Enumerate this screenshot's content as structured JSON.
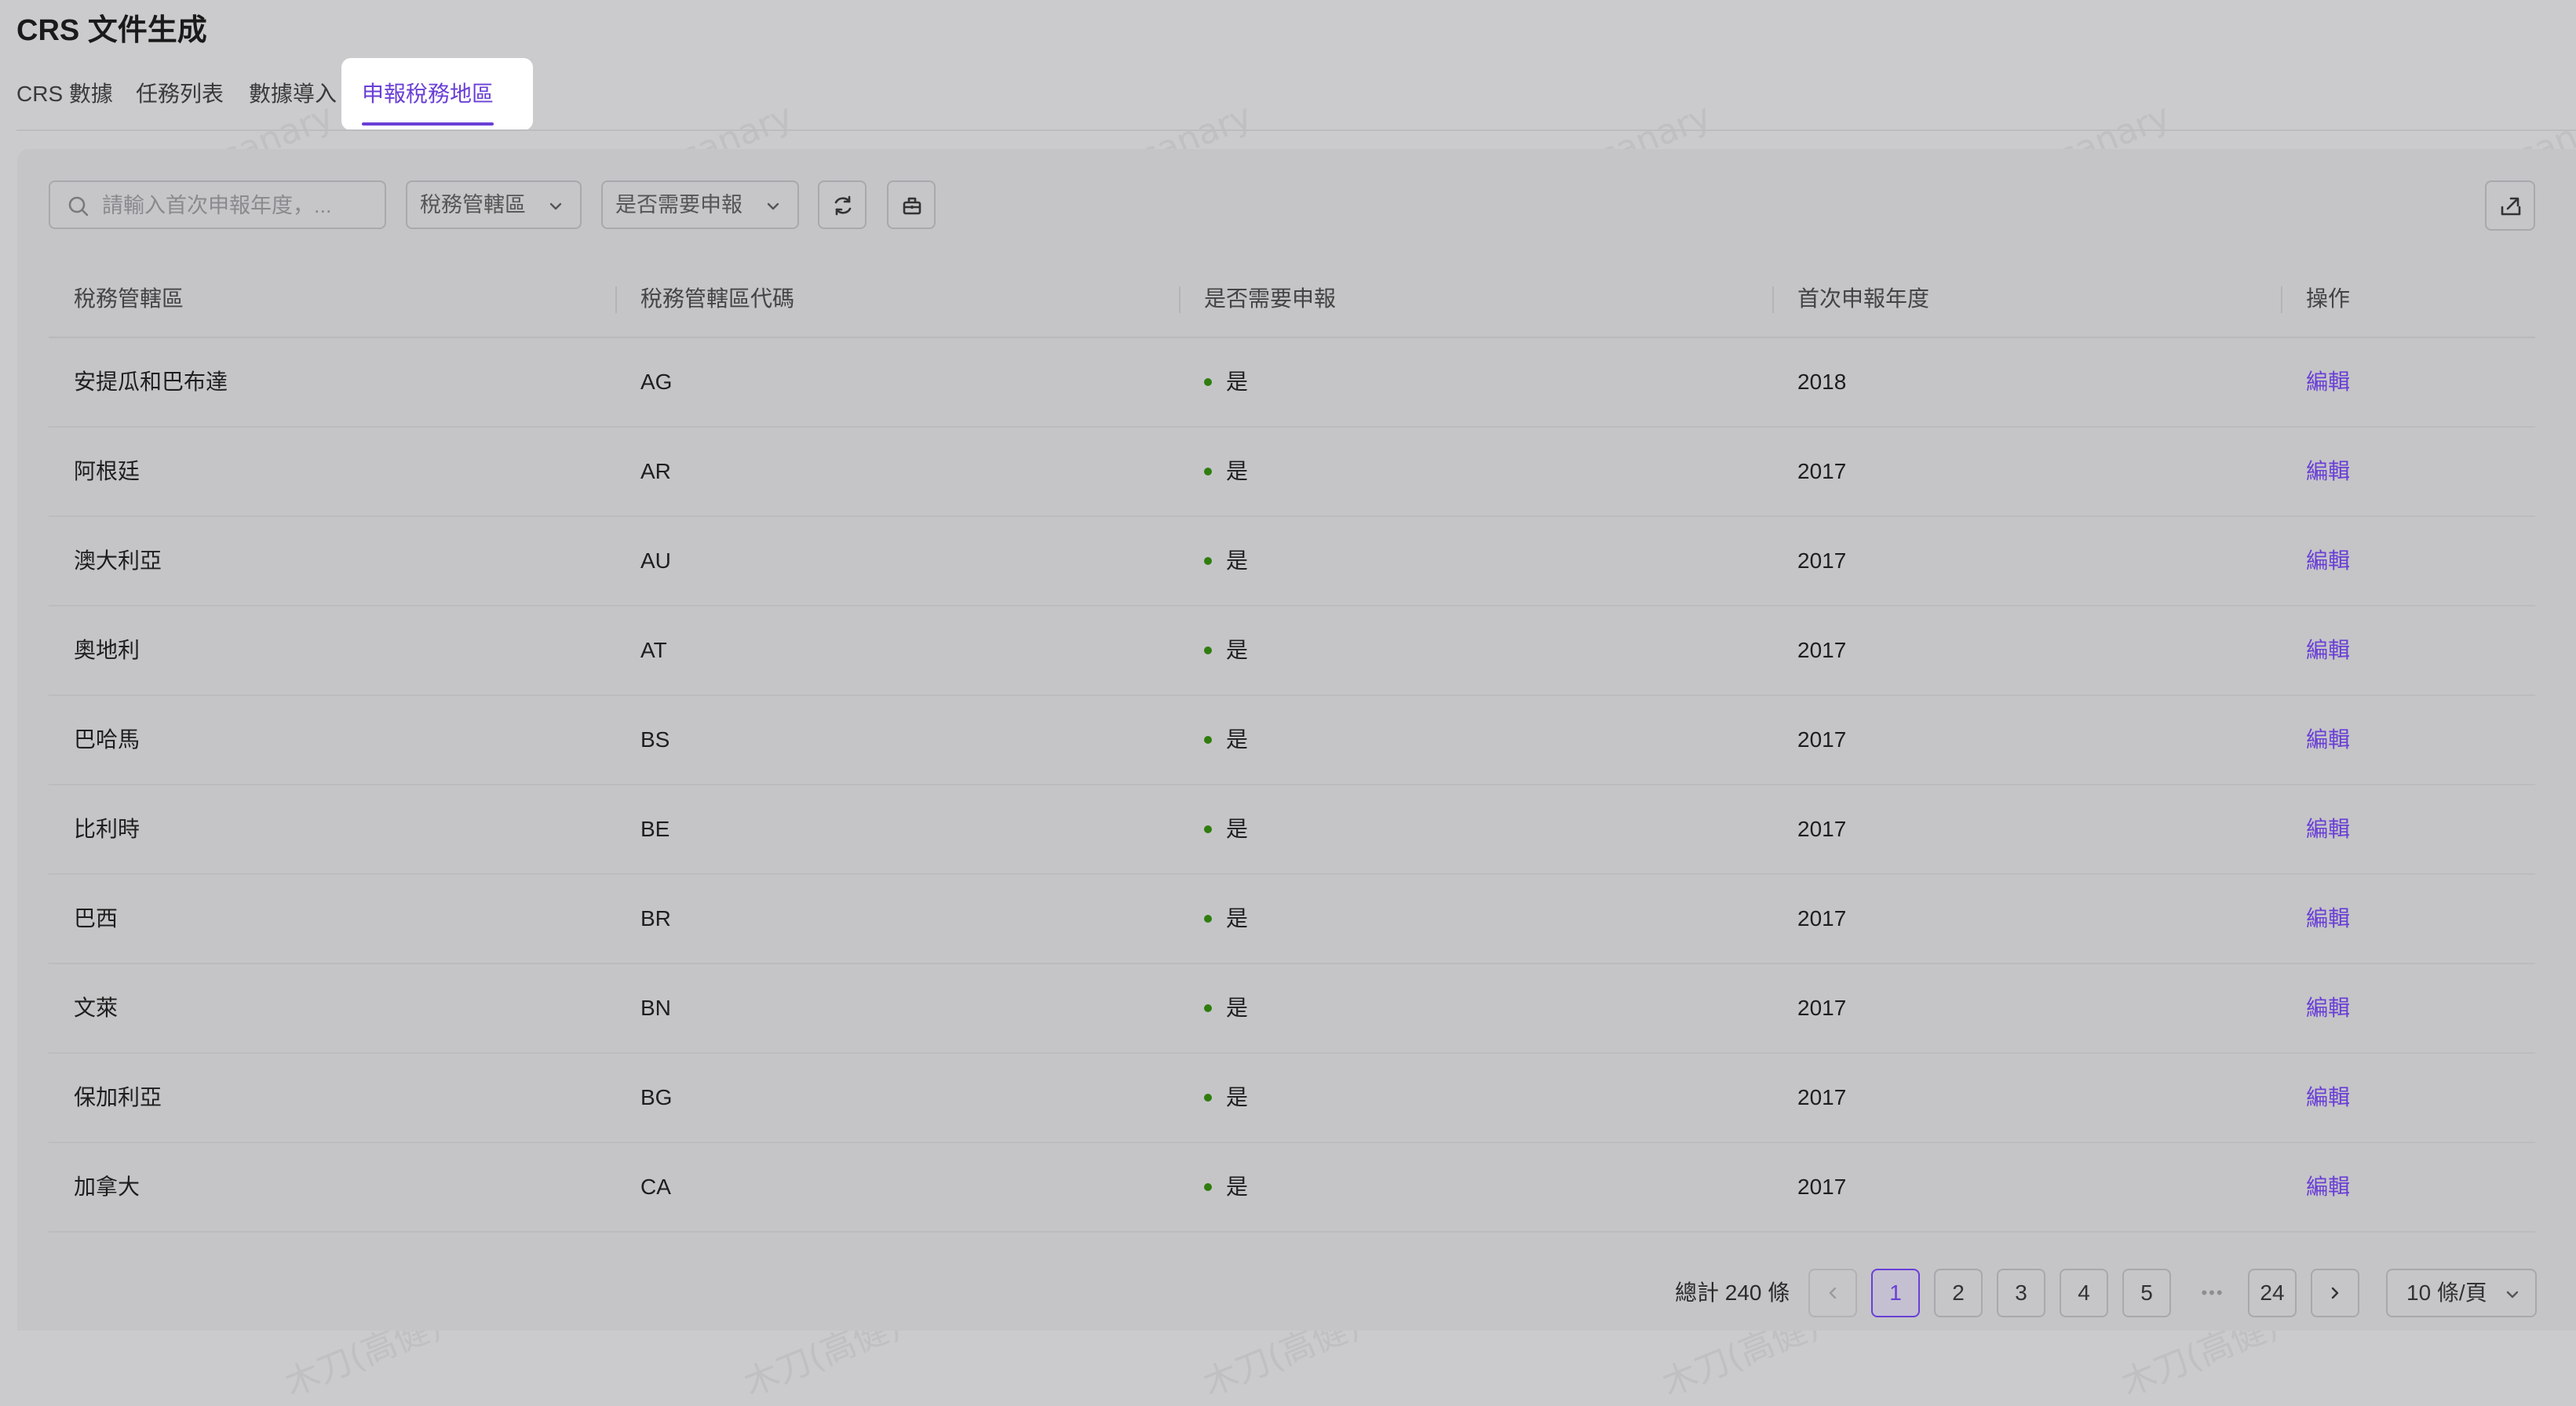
{
  "page": {
    "title": "CRS 文件生成"
  },
  "tabs": [
    {
      "label": "CRS 數據",
      "active": false
    },
    {
      "label": "任務列表",
      "active": false
    },
    {
      "label": "數據導入",
      "active": false
    },
    {
      "label": "申報稅務地區",
      "active": true
    }
  ],
  "toolbar": {
    "search_placeholder": "請輸入首次申報年度，...",
    "filter_jurisdiction": "稅務管轄區",
    "filter_needs_report": "是否需要申報",
    "refresh_icon": "refresh-icon",
    "clear_icon": "clear-filter-icon",
    "export_icon": "export-icon"
  },
  "table": {
    "columns": [
      "稅務管轄區",
      "稅務管轄區代碼",
      "是否需要申報",
      "首次申報年度",
      "操作"
    ],
    "rows": [
      {
        "name": "安提瓜和巴布達",
        "code": "AG",
        "needs_report": "是",
        "first_year": "2018",
        "action": "編輯"
      },
      {
        "name": "阿根廷",
        "code": "AR",
        "needs_report": "是",
        "first_year": "2017",
        "action": "編輯"
      },
      {
        "name": "澳大利亞",
        "code": "AU",
        "needs_report": "是",
        "first_year": "2017",
        "action": "編輯"
      },
      {
        "name": "奧地利",
        "code": "AT",
        "needs_report": "是",
        "first_year": "2017",
        "action": "編輯"
      },
      {
        "name": "巴哈馬",
        "code": "BS",
        "needs_report": "是",
        "first_year": "2017",
        "action": "編輯"
      },
      {
        "name": "比利時",
        "code": "BE",
        "needs_report": "是",
        "first_year": "2017",
        "action": "編輯"
      },
      {
        "name": "巴西",
        "code": "BR",
        "needs_report": "是",
        "first_year": "2017",
        "action": "編輯"
      },
      {
        "name": "文萊",
        "code": "BN",
        "needs_report": "是",
        "first_year": "2017",
        "action": "編輯"
      },
      {
        "name": "保加利亞",
        "code": "BG",
        "needs_report": "是",
        "first_year": "2017",
        "action": "編輯"
      },
      {
        "name": "加拿大",
        "code": "CA",
        "needs_report": "是",
        "first_year": "2017",
        "action": "編輯"
      }
    ],
    "status_color": "#2f7d0f"
  },
  "pagination": {
    "total_label": "總計 240 條",
    "pages": [
      "1",
      "2",
      "3",
      "4",
      "5"
    ],
    "ellipsis": "•••",
    "last_page": "24",
    "current_page": "1",
    "page_size": "10 條/頁"
  },
  "watermark": "木刀(高健) canary",
  "colors": {
    "accent": "#6a3fd6",
    "overlay_bg": "#cbcbcd"
  }
}
